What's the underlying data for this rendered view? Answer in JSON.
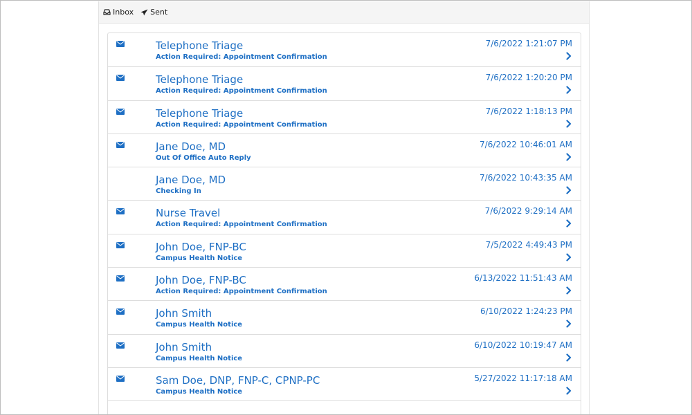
{
  "toolbar": {
    "inbox_label": "Inbox",
    "sent_label": "Sent",
    "inbox_icon": "inbox-icon",
    "sent_icon": "paper-plane-icon"
  },
  "colors": {
    "link": "#1e6fc4",
    "toolbar_bg": "#f5f5f5",
    "border": "#dddddd"
  },
  "messages": [
    {
      "sender": "Telephone Triage",
      "subject": "Action Required: Appointment Confirmation",
      "date": "7/6/2022 1:21:07 PM",
      "unread": true
    },
    {
      "sender": "Telephone Triage",
      "subject": "Action Required: Appointment Confirmation",
      "date": "7/6/2022 1:20:20 PM",
      "unread": true
    },
    {
      "sender": "Telephone Triage",
      "subject": "Action Required: Appointment Confirmation",
      "date": "7/6/2022 1:18:13 PM",
      "unread": true
    },
    {
      "sender": "Jane Doe, MD",
      "subject": "Out Of Office Auto Reply",
      "date": "7/6/2022 10:46:01 AM",
      "unread": true
    },
    {
      "sender": "Jane Doe, MD",
      "subject": "Checking In",
      "date": "7/6/2022 10:43:35 AM",
      "unread": false
    },
    {
      "sender": "Nurse Travel",
      "subject": "Action Required: Appointment Confirmation",
      "date": "7/6/2022 9:29:14 AM",
      "unread": true
    },
    {
      "sender": "John Doe, FNP-BC",
      "subject": "Campus Health Notice",
      "date": "7/5/2022 4:49:43 PM",
      "unread": true
    },
    {
      "sender": "John Doe, FNP-BC",
      "subject": "Action Required: Appointment Confirmation",
      "date": "6/13/2022 11:51:43 AM",
      "unread": true
    },
    {
      "sender": "John Smith",
      "subject": "Campus Health Notice",
      "date": "6/10/2022 1:24:23 PM",
      "unread": true
    },
    {
      "sender": "John Smith",
      "subject": "Campus Health Notice",
      "date": "6/10/2022 10:19:47 AM",
      "unread": true
    },
    {
      "sender": "Sam Doe, DNP, FNP-C, CPNP-PC",
      "subject": "Campus Health Notice",
      "date": "5/27/2022 11:17:18 AM",
      "unread": true
    },
    {
      "sender": "",
      "subject": "",
      "date": "",
      "unread": false
    }
  ]
}
